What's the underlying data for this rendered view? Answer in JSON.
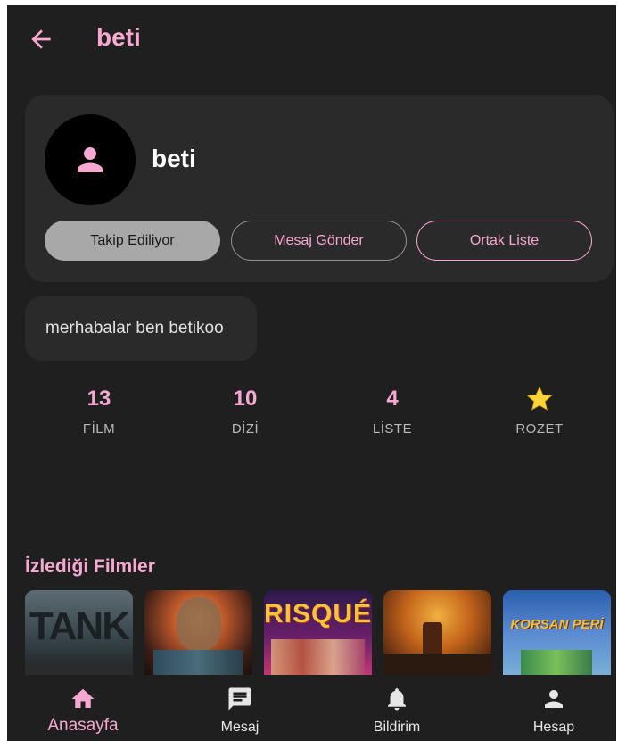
{
  "header": {
    "title": "beti",
    "back_icon": "arrow-left-icon"
  },
  "profile": {
    "name": "beti",
    "avatar_icon": "person-icon",
    "buttons": {
      "following": "Takip Ediliyor",
      "message": "Mesaj Gönder",
      "shared_list": "Ortak Liste"
    }
  },
  "bio": "merhabalar ben betikoo",
  "stats": [
    {
      "value": "13",
      "label": "FİLM"
    },
    {
      "value": "10",
      "label": "DİZİ"
    },
    {
      "value": "4",
      "label": "LİSTE"
    },
    {
      "icon": "star-icon",
      "label": "ROZET"
    }
  ],
  "watched_section": {
    "title": "İzlediği Filmler",
    "posters": [
      {
        "caption": "TANK"
      },
      {
        "caption": ""
      },
      {
        "caption": "RISQUÉ"
      },
      {
        "caption": ""
      },
      {
        "caption": "KORSAN PERİ"
      }
    ]
  },
  "nav": [
    {
      "label": "Anasayfa",
      "icon": "home-icon",
      "active": true
    },
    {
      "label": "Mesaj",
      "icon": "message-icon",
      "active": false
    },
    {
      "label": "Bildirim",
      "icon": "bell-icon",
      "active": false
    },
    {
      "label": "Hesap",
      "icon": "person-icon",
      "active": false
    }
  ],
  "colors": {
    "accent": "#f7a8d0",
    "background": "#1f1f1f",
    "card": "#2a2a2a",
    "star": "#ffd43b"
  }
}
